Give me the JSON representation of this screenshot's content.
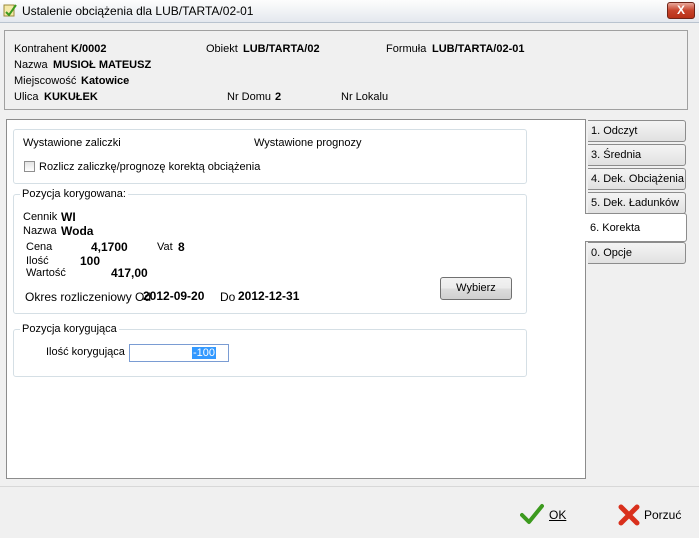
{
  "window": {
    "title": "Ustalenie obciążenia dla LUB/TARTA/02-01",
    "close_label": "X"
  },
  "header": {
    "kontrahent_label": "Kontrahent",
    "kontrahent_value": "K/0002",
    "obiekt_label": "Obiekt",
    "obiekt_value": "LUB/TARTA/02",
    "formula_label": "Formuła",
    "formula_value": "LUB/TARTA/02-01",
    "nazwa_label": "Nazwa",
    "nazwa_value": "MUSIOŁ MATEUSZ",
    "miejscowosc_label": "Miejscowość",
    "miejscowosc_value": "Katowice",
    "ulica_label": "Ulica",
    "ulica_value": "KUKUŁEK",
    "nr_domu_label": "Nr Domu",
    "nr_domu_value": "2",
    "nr_lokalu_label": "Nr Lokalu",
    "nr_lokalu_value": ""
  },
  "zaliczki": {
    "wystawione_zaliczki": "Wystawione zaliczki",
    "wystawione_prognozy": "Wystawione prognozy",
    "checkbox_label": "Rozlicz zaliczkę/prognozę korektą obciążenia",
    "checked": false
  },
  "pozycja_korygowana": {
    "title": "Pozycja korygowana:",
    "cennik_label": "Cennik",
    "cennik_value": "WI",
    "nazwa_label": "Nazwa",
    "nazwa_value": "Woda",
    "cena_label": "Cena",
    "cena_value": "4,1700",
    "vat_label": "Vat",
    "vat_value": "8",
    "ilosc_label": "Ilość",
    "ilosc_value": "100",
    "wartosc_label": "Wartość",
    "wartosc_value": "417,00",
    "okres_label": "Okres rozliczeniowy Od",
    "okres_od": "2012-09-20",
    "do_label": "Do",
    "okres_do": "2012-12-31",
    "wybierz_label": "Wybierz"
  },
  "pozycja_korygujaca": {
    "title": "Pozycja korygująca",
    "ilosc_label": "Ilość korygująca",
    "ilosc_value": "-100"
  },
  "tabs": [
    {
      "label": "1. Odczyt"
    },
    {
      "label": "3. Średnia"
    },
    {
      "label": "4. Dek. Obciążenia"
    },
    {
      "label": "5. Dek. Ładunków"
    },
    {
      "label": "6. Korekta"
    },
    {
      "label": "0. Opcje"
    }
  ],
  "active_tab": "6. Korekta",
  "buttons": {
    "ok_label": "OK",
    "porzuc_label": "Porzuć"
  },
  "colors": {
    "ok_icon": "#3c9a1e",
    "cancel_icon": "#d9301c",
    "selection": "#3399ff"
  }
}
